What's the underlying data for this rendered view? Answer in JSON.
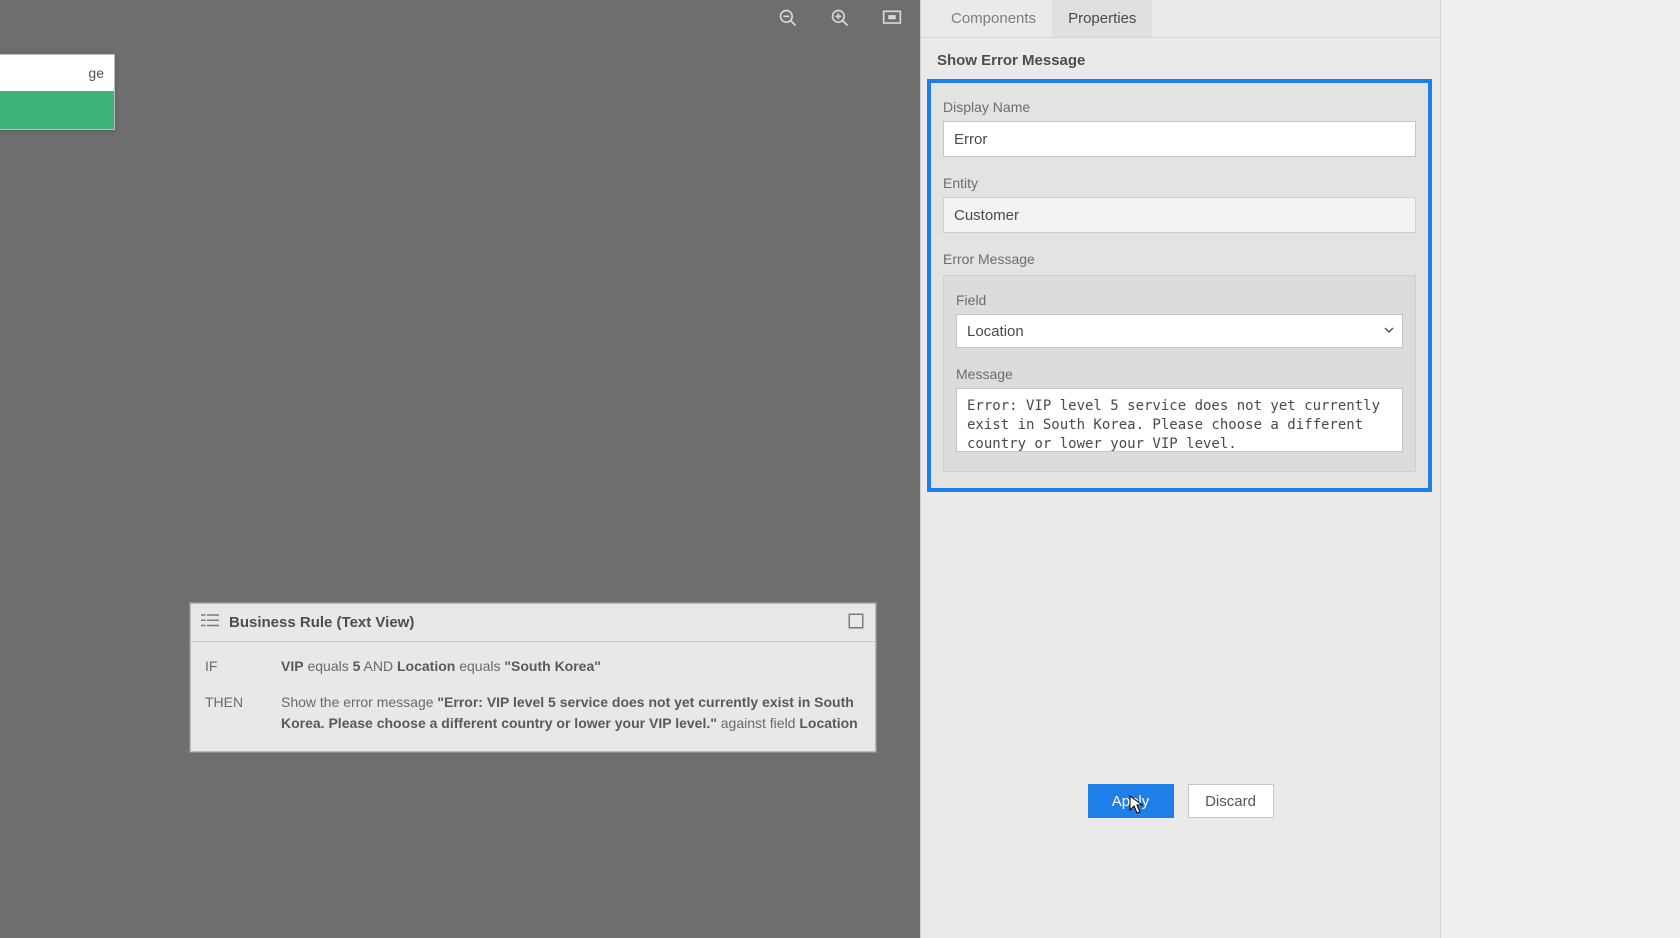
{
  "canvas": {
    "card_fragment_label_suffix": "ge",
    "toolbar": {
      "zoom_out_name": "zoom-out-icon",
      "zoom_in_name": "zoom-in-icon",
      "fit_name": "fit-to-screen-icon"
    }
  },
  "textview": {
    "title": "Business Rule (Text View)",
    "if_label": "IF",
    "then_label": "THEN",
    "if_parts": {
      "vip": "VIP",
      "equals1": " equals ",
      "five": "5",
      "and": " AND ",
      "location": "Location",
      "equals2": " equals ",
      "southkorea": "\"South Korea\""
    },
    "then_parts": {
      "prefix": "Show the error message ",
      "quoted": "\"Error: VIP level 5 service does not yet currently exist in South Korea. Please choose a different country or lower your VIP level.\"",
      "against": " against field ",
      "field": "Location"
    }
  },
  "side": {
    "tabs": {
      "components": "Components",
      "properties": "Properties"
    },
    "section_title": "Show Error Message",
    "labels": {
      "display_name": "Display Name",
      "entity": "Entity",
      "error_message": "Error Message",
      "field": "Field",
      "message": "Message"
    },
    "values": {
      "display_name": "Error",
      "entity": "Customer",
      "field_selected": "Location",
      "message": "Error: VIP level 5 service does not yet currently exist in South Korea. Please choose a different country or lower your VIP level."
    },
    "buttons": {
      "apply": "Apply",
      "discard": "Discard"
    }
  }
}
